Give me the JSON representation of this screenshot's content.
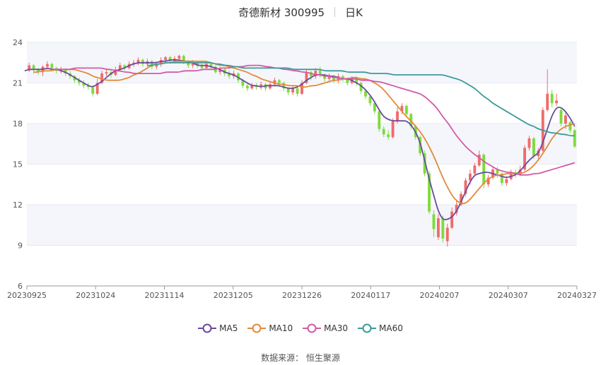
{
  "title": {
    "name": "奇德新材 300995",
    "period": "日K"
  },
  "source": {
    "label": "数据来源：",
    "value": "恒生聚源"
  },
  "chart_data": {
    "type": "candlestick",
    "ylim": [
      6,
      24
    ],
    "yticks": [
      6,
      9,
      12,
      15,
      18,
      21,
      24
    ],
    "xtick_labels": [
      "20230925",
      "20231024",
      "20231114",
      "20231205",
      "20231226",
      "20240117",
      "20240207",
      "20240307",
      "20240327"
    ],
    "colors": {
      "up": "#f06b6b",
      "down": "#7ddc3a",
      "ma5": "#6a4a9e",
      "ma10": "#e08b3a",
      "ma30": "#d45aa7",
      "ma60": "#3d9a9a",
      "band": "#f4f6fb"
    },
    "candles": [
      {
        "o": 22.0,
        "c": 22.3,
        "h": 22.5,
        "l": 21.8
      },
      {
        "o": 22.3,
        "c": 22.0,
        "h": 22.4,
        "l": 21.7
      },
      {
        "o": 22.0,
        "c": 21.8,
        "h": 22.1,
        "l": 21.6
      },
      {
        "o": 21.8,
        "c": 22.2,
        "h": 22.3,
        "l": 21.5
      },
      {
        "o": 22.2,
        "c": 22.4,
        "h": 22.6,
        "l": 22.0
      },
      {
        "o": 22.4,
        "c": 22.1,
        "h": 22.5,
        "l": 21.9
      },
      {
        "o": 22.1,
        "c": 21.9,
        "h": 22.2,
        "l": 21.7
      },
      {
        "o": 21.9,
        "c": 22.0,
        "h": 22.2,
        "l": 21.7
      },
      {
        "o": 22.0,
        "c": 21.7,
        "h": 22.1,
        "l": 21.5
      },
      {
        "o": 21.7,
        "c": 21.5,
        "h": 21.9,
        "l": 21.3
      },
      {
        "o": 21.5,
        "c": 21.2,
        "h": 21.6,
        "l": 21.0
      },
      {
        "o": 21.2,
        "c": 21.0,
        "h": 21.4,
        "l": 20.8
      },
      {
        "o": 21.0,
        "c": 20.8,
        "h": 21.2,
        "l": 20.6
      },
      {
        "o": 20.8,
        "c": 20.7,
        "h": 21.0,
        "l": 20.5
      },
      {
        "o": 20.7,
        "c": 20.2,
        "h": 20.8,
        "l": 20.0
      },
      {
        "o": 20.2,
        "c": 21.0,
        "h": 21.3,
        "l": 20.1
      },
      {
        "o": 21.0,
        "c": 21.7,
        "h": 21.9,
        "l": 20.9
      },
      {
        "o": 21.7,
        "c": 21.8,
        "h": 22.0,
        "l": 21.5
      },
      {
        "o": 21.8,
        "c": 21.6,
        "h": 22.0,
        "l": 21.4
      },
      {
        "o": 21.6,
        "c": 22.0,
        "h": 22.2,
        "l": 21.5
      },
      {
        "o": 22.0,
        "c": 22.3,
        "h": 22.5,
        "l": 21.9
      },
      {
        "o": 22.3,
        "c": 22.1,
        "h": 22.4,
        "l": 21.9
      },
      {
        "o": 22.1,
        "c": 22.4,
        "h": 22.6,
        "l": 22.0
      },
      {
        "o": 22.4,
        "c": 22.5,
        "h": 22.7,
        "l": 22.2
      },
      {
        "o": 22.5,
        "c": 22.7,
        "h": 22.9,
        "l": 22.3
      },
      {
        "o": 22.7,
        "c": 22.4,
        "h": 22.8,
        "l": 22.2
      },
      {
        "o": 22.4,
        "c": 22.6,
        "h": 22.8,
        "l": 22.2
      },
      {
        "o": 22.6,
        "c": 22.2,
        "h": 22.7,
        "l": 22.0
      },
      {
        "o": 22.2,
        "c": 22.4,
        "h": 22.6,
        "l": 22.0
      },
      {
        "o": 22.4,
        "c": 22.7,
        "h": 22.9,
        "l": 22.2
      },
      {
        "o": 22.7,
        "c": 22.9,
        "h": 23.0,
        "l": 22.5
      },
      {
        "o": 22.9,
        "c": 22.6,
        "h": 23.0,
        "l": 22.4
      },
      {
        "o": 22.6,
        "c": 22.8,
        "h": 23.0,
        "l": 22.5
      },
      {
        "o": 22.8,
        "c": 23.0,
        "h": 23.1,
        "l": 22.6
      },
      {
        "o": 23.0,
        "c": 22.6,
        "h": 23.1,
        "l": 22.4
      },
      {
        "o": 22.6,
        "c": 22.3,
        "h": 22.7,
        "l": 22.1
      },
      {
        "o": 22.3,
        "c": 22.5,
        "h": 22.7,
        "l": 22.1
      },
      {
        "o": 22.5,
        "c": 22.3,
        "h": 22.6,
        "l": 22.1
      },
      {
        "o": 22.3,
        "c": 22.1,
        "h": 22.4,
        "l": 21.9
      },
      {
        "o": 22.1,
        "c": 22.4,
        "h": 22.6,
        "l": 22.0
      },
      {
        "o": 22.4,
        "c": 22.2,
        "h": 22.5,
        "l": 22.0
      },
      {
        "o": 22.2,
        "c": 21.8,
        "h": 22.3,
        "l": 21.7
      },
      {
        "o": 21.8,
        "c": 22.0,
        "h": 22.2,
        "l": 21.6
      },
      {
        "o": 22.0,
        "c": 21.7,
        "h": 22.1,
        "l": 21.5
      },
      {
        "o": 21.7,
        "c": 21.5,
        "h": 21.9,
        "l": 21.3
      },
      {
        "o": 21.5,
        "c": 21.7,
        "h": 21.9,
        "l": 21.3
      },
      {
        "o": 21.7,
        "c": 21.2,
        "h": 21.8,
        "l": 21.0
      },
      {
        "o": 21.2,
        "c": 20.8,
        "h": 21.3,
        "l": 20.6
      },
      {
        "o": 20.8,
        "c": 20.6,
        "h": 21.0,
        "l": 20.4
      },
      {
        "o": 20.6,
        "c": 20.8,
        "h": 21.0,
        "l": 20.5
      },
      {
        "o": 20.8,
        "c": 20.7,
        "h": 21.0,
        "l": 20.5
      },
      {
        "o": 20.7,
        "c": 20.9,
        "h": 21.1,
        "l": 20.5
      },
      {
        "o": 20.9,
        "c": 20.6,
        "h": 21.0,
        "l": 20.4
      },
      {
        "o": 20.6,
        "c": 20.9,
        "h": 21.1,
        "l": 20.5
      },
      {
        "o": 20.9,
        "c": 21.2,
        "h": 21.4,
        "l": 20.8
      },
      {
        "o": 21.2,
        "c": 21.0,
        "h": 21.3,
        "l": 20.8
      },
      {
        "o": 21.0,
        "c": 20.6,
        "h": 21.1,
        "l": 20.4
      },
      {
        "o": 20.6,
        "c": 20.3,
        "h": 20.7,
        "l": 20.1
      },
      {
        "o": 20.3,
        "c": 20.6,
        "h": 20.8,
        "l": 20.1
      },
      {
        "o": 20.6,
        "c": 20.2,
        "h": 20.7,
        "l": 20.0
      },
      {
        "o": 20.2,
        "c": 21.0,
        "h": 21.2,
        "l": 20.1
      },
      {
        "o": 21.0,
        "c": 21.8,
        "h": 22.0,
        "l": 20.9
      },
      {
        "o": 21.8,
        "c": 21.5,
        "h": 21.9,
        "l": 21.2
      },
      {
        "o": 21.5,
        "c": 21.9,
        "h": 22.1,
        "l": 21.3
      },
      {
        "o": 21.9,
        "c": 21.6,
        "h": 22.2,
        "l": 21.4
      },
      {
        "o": 21.6,
        "c": 21.3,
        "h": 21.7,
        "l": 21.1
      },
      {
        "o": 21.3,
        "c": 21.5,
        "h": 21.7,
        "l": 21.1
      },
      {
        "o": 21.5,
        "c": 21.2,
        "h": 21.6,
        "l": 21.0
      },
      {
        "o": 21.2,
        "c": 21.5,
        "h": 21.7,
        "l": 21.0
      },
      {
        "o": 21.5,
        "c": 21.3,
        "h": 21.6,
        "l": 21.1
      },
      {
        "o": 21.3,
        "c": 21.0,
        "h": 21.4,
        "l": 20.8
      },
      {
        "o": 21.0,
        "c": 21.4,
        "h": 21.5,
        "l": 20.9
      },
      {
        "o": 21.4,
        "c": 21.0,
        "h": 21.5,
        "l": 20.8
      },
      {
        "o": 21.0,
        "c": 20.4,
        "h": 21.1,
        "l": 20.2
      },
      {
        "o": 20.4,
        "c": 20.0,
        "h": 20.5,
        "l": 19.8
      },
      {
        "o": 20.0,
        "c": 19.5,
        "h": 20.1,
        "l": 19.3
      },
      {
        "o": 19.5,
        "c": 18.9,
        "h": 19.6,
        "l": 18.7
      },
      {
        "o": 18.9,
        "c": 17.6,
        "h": 19.0,
        "l": 17.4
      },
      {
        "o": 17.6,
        "c": 17.2,
        "h": 17.8,
        "l": 17.0
      },
      {
        "o": 17.2,
        "c": 17.0,
        "h": 17.5,
        "l": 16.8
      },
      {
        "o": 17.0,
        "c": 18.2,
        "h": 18.4,
        "l": 16.9
      },
      {
        "o": 18.2,
        "c": 18.9,
        "h": 19.2,
        "l": 18.0
      },
      {
        "o": 18.9,
        "c": 19.3,
        "h": 19.5,
        "l": 18.7
      },
      {
        "o": 19.3,
        "c": 18.7,
        "h": 19.4,
        "l": 18.5
      },
      {
        "o": 18.7,
        "c": 17.8,
        "h": 18.8,
        "l": 17.6
      },
      {
        "o": 17.8,
        "c": 17.0,
        "h": 17.9,
        "l": 16.8
      },
      {
        "o": 17.0,
        "c": 15.8,
        "h": 17.1,
        "l": 15.6
      },
      {
        "o": 15.8,
        "c": 14.3,
        "h": 16.0,
        "l": 14.1
      },
      {
        "o": 14.3,
        "c": 11.5,
        "h": 14.5,
        "l": 11.3
      },
      {
        "o": 11.3,
        "c": 10.2,
        "h": 11.6,
        "l": 9.6
      },
      {
        "o": 9.6,
        "c": 11.0,
        "h": 11.3,
        "l": 9.4
      },
      {
        "o": 11.0,
        "c": 9.5,
        "h": 11.2,
        "l": 9.2
      },
      {
        "o": 9.3,
        "c": 10.3,
        "h": 10.6,
        "l": 8.9
      },
      {
        "o": 10.3,
        "c": 11.5,
        "h": 11.8,
        "l": 10.2
      },
      {
        "o": 11.4,
        "c": 12.0,
        "h": 12.3,
        "l": 11.2
      },
      {
        "o": 12.0,
        "c": 12.8,
        "h": 13.0,
        "l": 11.9
      },
      {
        "o": 12.8,
        "c": 13.8,
        "h": 14.0,
        "l": 12.6
      },
      {
        "o": 13.8,
        "c": 14.3,
        "h": 14.6,
        "l": 13.5
      },
      {
        "o": 14.3,
        "c": 14.9,
        "h": 15.1,
        "l": 14.1
      },
      {
        "o": 14.9,
        "c": 15.7,
        "h": 16.0,
        "l": 14.8
      },
      {
        "o": 15.7,
        "c": 13.5,
        "h": 15.8,
        "l": 13.2
      },
      {
        "o": 13.5,
        "c": 14.0,
        "h": 14.2,
        "l": 13.3
      },
      {
        "o": 14.0,
        "c": 14.6,
        "h": 14.8,
        "l": 13.9
      },
      {
        "o": 14.6,
        "c": 14.3,
        "h": 14.8,
        "l": 14.0
      },
      {
        "o": 14.3,
        "c": 13.6,
        "h": 14.4,
        "l": 13.4
      },
      {
        "o": 13.6,
        "c": 13.9,
        "h": 14.1,
        "l": 13.4
      },
      {
        "o": 13.9,
        "c": 14.4,
        "h": 14.6,
        "l": 13.8
      },
      {
        "o": 14.4,
        "c": 14.2,
        "h": 14.6,
        "l": 14.0
      },
      {
        "o": 14.2,
        "c": 14.6,
        "h": 14.9,
        "l": 14.1
      },
      {
        "o": 14.6,
        "c": 16.2,
        "h": 16.4,
        "l": 14.5
      },
      {
        "o": 16.2,
        "c": 16.9,
        "h": 17.1,
        "l": 16.0
      },
      {
        "o": 16.9,
        "c": 15.6,
        "h": 17.0,
        "l": 15.4
      },
      {
        "o": 15.6,
        "c": 16.0,
        "h": 16.2,
        "l": 15.4
      },
      {
        "o": 16.0,
        "c": 19.0,
        "h": 19.2,
        "l": 15.9
      },
      {
        "o": 19.0,
        "c": 20.2,
        "h": 22.0,
        "l": 18.9
      },
      {
        "o": 20.2,
        "c": 19.5,
        "h": 20.5,
        "l": 19.2
      },
      {
        "o": 19.5,
        "c": 19.7,
        "h": 20.2,
        "l": 19.3
      },
      {
        "o": 19.0,
        "c": 18.0,
        "h": 19.2,
        "l": 17.8
      },
      {
        "o": 18.0,
        "c": 18.6,
        "h": 18.8,
        "l": 17.6
      },
      {
        "o": 18.1,
        "c": 17.5,
        "h": 18.2,
        "l": 17.3
      },
      {
        "o": 17.5,
        "c": 16.3,
        "h": 17.6,
        "l": 16.2
      }
    ],
    "series": [
      {
        "name": "MA5",
        "values": [
          21.9,
          22.0,
          22.0,
          22.0,
          22.0,
          22.1,
          22.0,
          22.0,
          21.9,
          21.8,
          21.6,
          21.4,
          21.2,
          21.0,
          20.8,
          20.7,
          20.9,
          21.1,
          21.4,
          21.7,
          21.9,
          22.0,
          22.1,
          22.3,
          22.4,
          22.5,
          22.5,
          22.5,
          22.5,
          22.5,
          22.6,
          22.6,
          22.7,
          22.7,
          22.7,
          22.6,
          22.6,
          22.5,
          22.3,
          22.3,
          22.3,
          22.2,
          22.1,
          22.0,
          21.8,
          21.7,
          21.6,
          21.4,
          21.2,
          21.0,
          20.8,
          20.8,
          20.7,
          20.8,
          20.8,
          20.8,
          20.8,
          20.7,
          20.6,
          20.6,
          20.7,
          20.9,
          21.2,
          21.4,
          21.6,
          21.6,
          21.6,
          21.5,
          21.5,
          21.4,
          21.3,
          21.3,
          21.2,
          21.0,
          20.8,
          20.5,
          20.1,
          19.6,
          19.0,
          18.5,
          18.3,
          18.2,
          18.2,
          18.2,
          18.2,
          17.9,
          17.4,
          16.6,
          15.3,
          13.9,
          12.7,
          11.5,
          10.9,
          10.9,
          11.1,
          11.5,
          12.2,
          13.0,
          13.7,
          14.2,
          14.3,
          14.4,
          14.4,
          14.3,
          14.2,
          14.1,
          14.0,
          14.1,
          14.2,
          14.5,
          14.9,
          15.3,
          15.6,
          15.8,
          16.6,
          17.6,
          18.6,
          19.2,
          19.2,
          18.9,
          18.4,
          17.8
        ],
        "color": "#6a4a9e"
      },
      {
        "name": "MA10",
        "values": [
          21.8,
          21.8,
          21.9,
          21.9,
          21.9,
          22.0,
          22.0,
          22.0,
          22.0,
          22.0,
          21.9,
          21.8,
          21.7,
          21.5,
          21.4,
          21.3,
          21.2,
          21.2,
          21.2,
          21.2,
          21.3,
          21.4,
          21.6,
          21.7,
          21.9,
          22.1,
          22.3,
          22.4,
          22.4,
          22.5,
          22.5,
          22.6,
          22.6,
          22.6,
          22.6,
          22.6,
          22.6,
          22.6,
          22.6,
          22.5,
          22.4,
          22.3,
          22.3,
          22.2,
          22.1,
          22.0,
          21.9,
          21.8,
          21.6,
          21.5,
          21.3,
          21.2,
          21.1,
          21.0,
          20.9,
          20.9,
          20.8,
          20.8,
          20.8,
          20.7,
          20.7,
          20.8,
          20.8,
          20.9,
          21.0,
          21.1,
          21.2,
          21.2,
          21.3,
          21.3,
          21.4,
          21.4,
          21.3,
          21.3,
          21.2,
          21.0,
          20.8,
          20.5,
          20.1,
          19.7,
          19.3,
          18.9,
          18.5,
          18.2,
          17.8,
          17.4,
          16.9,
          16.3,
          15.6,
          14.8,
          14.0,
          13.3,
          12.7,
          12.3,
          12.1,
          12.1,
          12.4,
          12.8,
          13.2,
          13.6,
          13.9,
          14.1,
          14.2,
          14.2,
          14.3,
          14.3,
          14.3,
          14.3,
          14.4,
          14.6,
          14.9,
          15.3,
          15.8,
          16.3,
          16.9,
          17.3,
          17.6,
          17.8,
          17.9,
          18.0
        ],
        "color": "#e08b3a"
      },
      {
        "name": "MA30",
        "values": [
          22.0,
          22.0,
          22.0,
          22.0,
          22.0,
          22.1,
          22.1,
          22.1,
          22.1,
          22.1,
          22.1,
          22.1,
          22.0,
          22.0,
          21.9,
          21.9,
          21.8,
          21.8,
          21.7,
          21.7,
          21.7,
          21.7,
          21.7,
          21.7,
          21.7,
          21.8,
          21.8,
          21.8,
          21.8,
          21.9,
          21.9,
          21.9,
          21.9,
          22.0,
          22.0,
          22.0,
          22.0,
          22.1,
          22.1,
          22.1,
          22.2,
          22.2,
          22.2,
          22.3,
          22.3,
          22.3,
          22.3,
          22.2,
          22.2,
          22.1,
          22.1,
          22.0,
          22.0,
          21.9,
          21.9,
          21.8,
          21.8,
          21.7,
          21.6,
          21.6,
          21.5,
          21.5,
          21.4,
          21.4,
          21.3,
          21.3,
          21.3,
          21.3,
          21.2,
          21.2,
          21.2,
          21.1,
          21.1,
          21.0,
          20.9,
          20.8,
          20.7,
          20.6,
          20.5,
          20.4,
          20.3,
          20.2,
          20.0,
          19.7,
          19.4,
          19.0,
          18.5,
          18.1,
          17.6,
          17.1,
          16.7,
          16.3,
          16.0,
          15.7,
          15.5,
          15.2,
          15.0,
          14.8,
          14.6,
          14.5,
          14.4,
          14.4,
          14.3,
          14.2,
          14.2,
          14.2,
          14.3,
          14.3,
          14.4,
          14.5,
          14.6,
          14.7,
          14.8,
          14.9,
          15.0,
          15.1
        ],
        "color": "#d45aa7"
      },
      {
        "name": "MA60",
        "values": [
          22.3,
          22.3,
          22.4,
          22.4,
          22.5,
          22.5,
          22.5,
          22.5,
          22.5,
          22.5,
          22.5,
          22.5,
          22.5,
          22.5,
          22.5,
          22.4,
          22.4,
          22.3,
          22.3,
          22.2,
          22.2,
          22.1,
          22.1,
          22.1,
          22.1,
          22.1,
          22.1,
          22.1,
          22.1,
          22.1,
          22.1,
          22.1,
          22.0,
          22.0,
          22.0,
          22.0,
          22.0,
          22.0,
          22.0,
          21.9,
          21.9,
          21.9,
          21.9,
          21.9,
          21.8,
          21.8,
          21.8,
          21.8,
          21.8,
          21.7,
          21.7,
          21.7,
          21.7,
          21.7,
          21.6,
          21.6,
          21.6,
          21.6,
          21.6,
          21.6,
          21.6,
          21.6,
          21.6,
          21.6,
          21.6,
          21.6,
          21.5,
          21.4,
          21.3,
          21.2,
          21.0,
          20.8,
          20.6,
          20.3,
          20.0,
          19.8,
          19.5,
          19.3,
          19.1,
          18.9,
          18.7,
          18.5,
          18.3,
          18.1,
          17.9,
          17.8,
          17.6,
          17.5,
          17.4,
          17.3,
          17.3,
          17.2,
          17.2,
          17.1,
          17.1
        ],
        "color": "#3d9a9a"
      }
    ]
  },
  "legend": [
    {
      "label": "MA5",
      "color": "#6a4a9e"
    },
    {
      "label": "MA10",
      "color": "#e08b3a"
    },
    {
      "label": "MA30",
      "color": "#d45aa7"
    },
    {
      "label": "MA60",
      "color": "#3d9a9a"
    }
  ]
}
